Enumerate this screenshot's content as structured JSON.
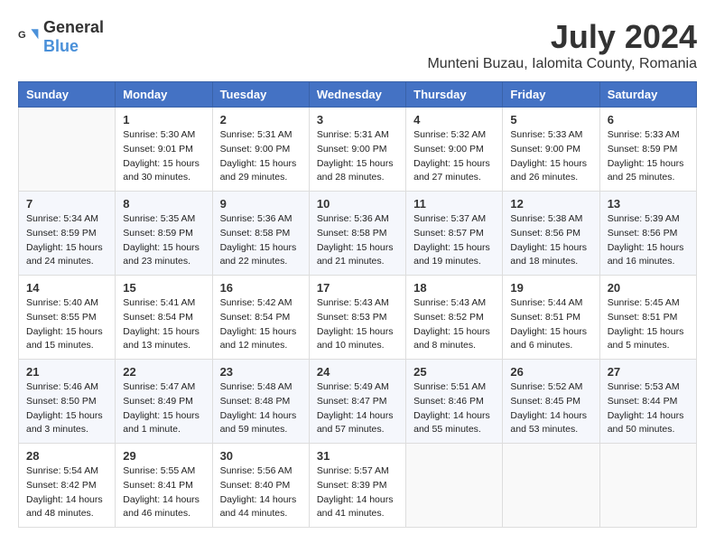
{
  "header": {
    "logo_general": "General",
    "logo_blue": "Blue",
    "month_year": "July 2024",
    "location": "Munteni Buzau, Ialomita County, Romania"
  },
  "calendar": {
    "days_of_week": [
      "Sunday",
      "Monday",
      "Tuesday",
      "Wednesday",
      "Thursday",
      "Friday",
      "Saturday"
    ],
    "weeks": [
      {
        "days": [
          {
            "number": "",
            "info": ""
          },
          {
            "number": "1",
            "info": "Sunrise: 5:30 AM\nSunset: 9:01 PM\nDaylight: 15 hours\nand 30 minutes."
          },
          {
            "number": "2",
            "info": "Sunrise: 5:31 AM\nSunset: 9:00 PM\nDaylight: 15 hours\nand 29 minutes."
          },
          {
            "number": "3",
            "info": "Sunrise: 5:31 AM\nSunset: 9:00 PM\nDaylight: 15 hours\nand 28 minutes."
          },
          {
            "number": "4",
            "info": "Sunrise: 5:32 AM\nSunset: 9:00 PM\nDaylight: 15 hours\nand 27 minutes."
          },
          {
            "number": "5",
            "info": "Sunrise: 5:33 AM\nSunset: 9:00 PM\nDaylight: 15 hours\nand 26 minutes."
          },
          {
            "number": "6",
            "info": "Sunrise: 5:33 AM\nSunset: 8:59 PM\nDaylight: 15 hours\nand 25 minutes."
          }
        ]
      },
      {
        "days": [
          {
            "number": "7",
            "info": "Sunrise: 5:34 AM\nSunset: 8:59 PM\nDaylight: 15 hours\nand 24 minutes."
          },
          {
            "number": "8",
            "info": "Sunrise: 5:35 AM\nSunset: 8:59 PM\nDaylight: 15 hours\nand 23 minutes."
          },
          {
            "number": "9",
            "info": "Sunrise: 5:36 AM\nSunset: 8:58 PM\nDaylight: 15 hours\nand 22 minutes."
          },
          {
            "number": "10",
            "info": "Sunrise: 5:36 AM\nSunset: 8:58 PM\nDaylight: 15 hours\nand 21 minutes."
          },
          {
            "number": "11",
            "info": "Sunrise: 5:37 AM\nSunset: 8:57 PM\nDaylight: 15 hours\nand 19 minutes."
          },
          {
            "number": "12",
            "info": "Sunrise: 5:38 AM\nSunset: 8:56 PM\nDaylight: 15 hours\nand 18 minutes."
          },
          {
            "number": "13",
            "info": "Sunrise: 5:39 AM\nSunset: 8:56 PM\nDaylight: 15 hours\nand 16 minutes."
          }
        ]
      },
      {
        "days": [
          {
            "number": "14",
            "info": "Sunrise: 5:40 AM\nSunset: 8:55 PM\nDaylight: 15 hours\nand 15 minutes."
          },
          {
            "number": "15",
            "info": "Sunrise: 5:41 AM\nSunset: 8:54 PM\nDaylight: 15 hours\nand 13 minutes."
          },
          {
            "number": "16",
            "info": "Sunrise: 5:42 AM\nSunset: 8:54 PM\nDaylight: 15 hours\nand 12 minutes."
          },
          {
            "number": "17",
            "info": "Sunrise: 5:43 AM\nSunset: 8:53 PM\nDaylight: 15 hours\nand 10 minutes."
          },
          {
            "number": "18",
            "info": "Sunrise: 5:43 AM\nSunset: 8:52 PM\nDaylight: 15 hours\nand 8 minutes."
          },
          {
            "number": "19",
            "info": "Sunrise: 5:44 AM\nSunset: 8:51 PM\nDaylight: 15 hours\nand 6 minutes."
          },
          {
            "number": "20",
            "info": "Sunrise: 5:45 AM\nSunset: 8:51 PM\nDaylight: 15 hours\nand 5 minutes."
          }
        ]
      },
      {
        "days": [
          {
            "number": "21",
            "info": "Sunrise: 5:46 AM\nSunset: 8:50 PM\nDaylight: 15 hours\nand 3 minutes."
          },
          {
            "number": "22",
            "info": "Sunrise: 5:47 AM\nSunset: 8:49 PM\nDaylight: 15 hours\nand 1 minute."
          },
          {
            "number": "23",
            "info": "Sunrise: 5:48 AM\nSunset: 8:48 PM\nDaylight: 14 hours\nand 59 minutes."
          },
          {
            "number": "24",
            "info": "Sunrise: 5:49 AM\nSunset: 8:47 PM\nDaylight: 14 hours\nand 57 minutes."
          },
          {
            "number": "25",
            "info": "Sunrise: 5:51 AM\nSunset: 8:46 PM\nDaylight: 14 hours\nand 55 minutes."
          },
          {
            "number": "26",
            "info": "Sunrise: 5:52 AM\nSunset: 8:45 PM\nDaylight: 14 hours\nand 53 minutes."
          },
          {
            "number": "27",
            "info": "Sunrise: 5:53 AM\nSunset: 8:44 PM\nDaylight: 14 hours\nand 50 minutes."
          }
        ]
      },
      {
        "days": [
          {
            "number": "28",
            "info": "Sunrise: 5:54 AM\nSunset: 8:42 PM\nDaylight: 14 hours\nand 48 minutes."
          },
          {
            "number": "29",
            "info": "Sunrise: 5:55 AM\nSunset: 8:41 PM\nDaylight: 14 hours\nand 46 minutes."
          },
          {
            "number": "30",
            "info": "Sunrise: 5:56 AM\nSunset: 8:40 PM\nDaylight: 14 hours\nand 44 minutes."
          },
          {
            "number": "31",
            "info": "Sunrise: 5:57 AM\nSunset: 8:39 PM\nDaylight: 14 hours\nand 41 minutes."
          },
          {
            "number": "",
            "info": ""
          },
          {
            "number": "",
            "info": ""
          },
          {
            "number": "",
            "info": ""
          }
        ]
      }
    ]
  }
}
